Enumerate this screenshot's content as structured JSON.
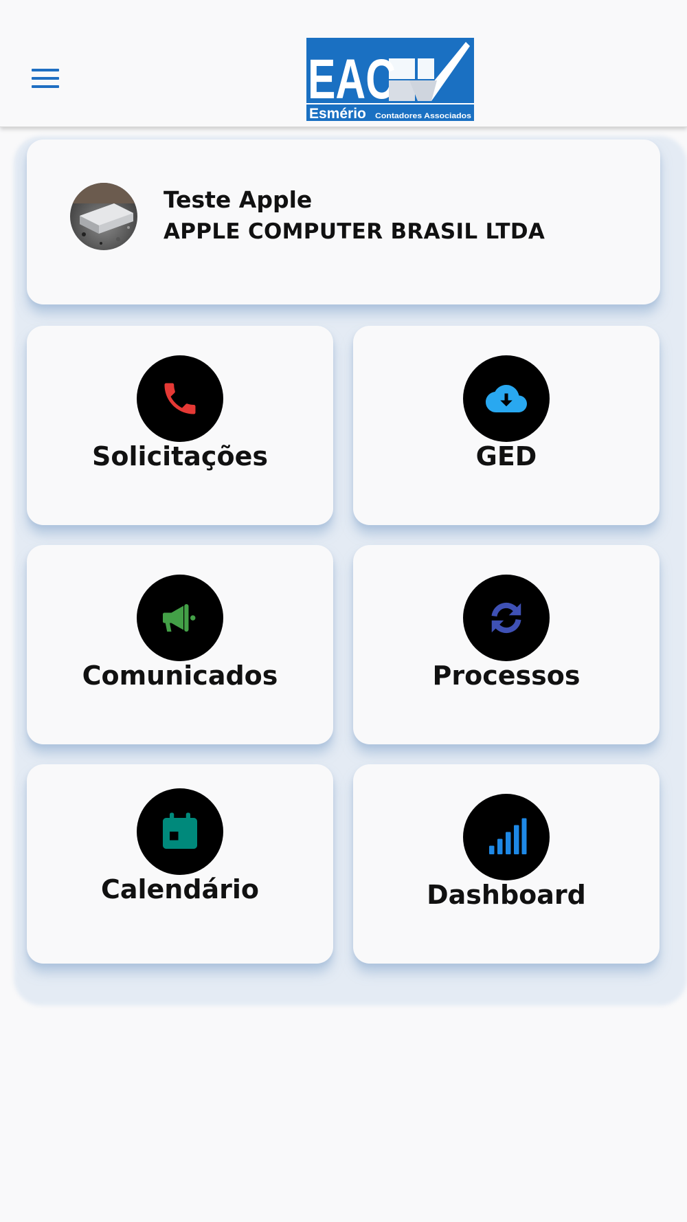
{
  "header": {
    "menu_icon": "hamburger-menu-icon",
    "logo": {
      "main_text": "EAC",
      "brand_text": "Esmério",
      "sub_text": "Contadores Associados",
      "color": "#1a70c2"
    }
  },
  "profile": {
    "avatar_icon": "user-avatar",
    "name": "Teste Apple",
    "company": "APPLE COMPUTER BRASIL LTDA"
  },
  "tiles": [
    {
      "label": "Solicitações",
      "icon": "phone-icon",
      "icon_color": "#e53935"
    },
    {
      "label": "GED",
      "icon": "cloud-download-icon",
      "icon_color": "#29a8f0"
    },
    {
      "label": "Comunicados",
      "icon": "megaphone-icon",
      "icon_color": "#43a047"
    },
    {
      "label": "Processos",
      "icon": "sync-icon",
      "icon_color": "#3f51b5"
    },
    {
      "label": "Calendário",
      "icon": "calendar-icon",
      "icon_color": "#00897b"
    },
    {
      "label": "Dashboard",
      "icon": "signal-bars-icon",
      "icon_color": "#1e88e5"
    }
  ]
}
